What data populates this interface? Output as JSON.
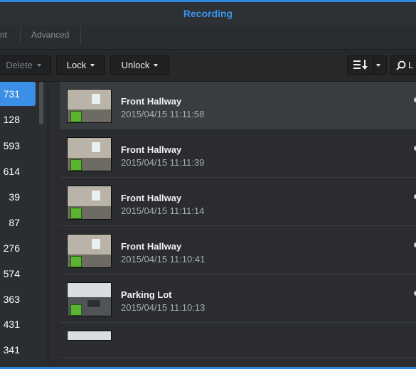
{
  "window": {
    "title": "Recording"
  },
  "tabs": [
    {
      "label": "nt"
    },
    {
      "label": "Advanced"
    }
  ],
  "toolbar": {
    "delete_label": "Delete",
    "lock_label": "Lock",
    "unlock_label": "Unlock",
    "search_partial": "L"
  },
  "sidebar": {
    "counts": [
      "731",
      "128",
      "593",
      "614",
      "39",
      "87",
      "276",
      "574",
      "363",
      "431",
      "341"
    ],
    "selected_index": 0
  },
  "recordings": [
    {
      "camera": "Front Hallway",
      "timestamp": "2015/04/15 11:11:58",
      "thumb": "hallway",
      "selected": true
    },
    {
      "camera": "Front Hallway",
      "timestamp": "2015/04/15 11:11:39",
      "thumb": "hallway",
      "selected": false
    },
    {
      "camera": "Front Hallway",
      "timestamp": "2015/04/15 11:11:14",
      "thumb": "hallway",
      "selected": false
    },
    {
      "camera": "Front Hallway",
      "timestamp": "2015/04/15 11:10:41",
      "thumb": "hallway",
      "selected": false
    },
    {
      "camera": "Parking Lot",
      "timestamp": "2015/04/15 11:10:13",
      "thumb": "parking",
      "selected": false
    }
  ],
  "icons": {
    "sort": "sort-icon",
    "search": "search-icon",
    "status_badge": "recording-status-icon"
  },
  "colors": {
    "accent": "#3b96ee",
    "selection": "#3b8fe6",
    "badge_green": "#5bb332"
  }
}
